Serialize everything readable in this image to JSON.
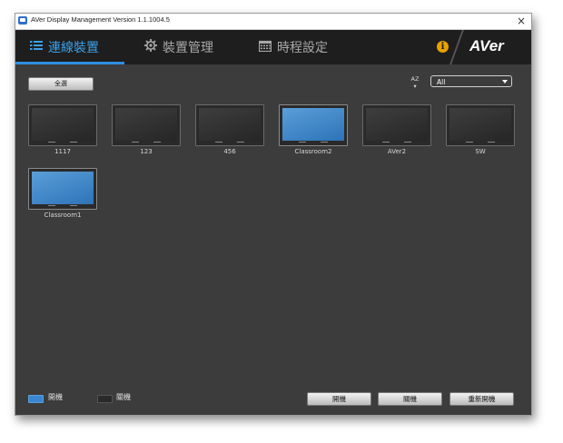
{
  "window": {
    "title": "AVer Display Management Version 1.1.1004.5",
    "close_label": "×"
  },
  "tabs": [
    {
      "label": "連線裝置",
      "icon": "list-icon",
      "active": true
    },
    {
      "label": "裝置管理",
      "icon": "gear-icon",
      "active": false
    },
    {
      "label": "時程設定",
      "icon": "calendar-icon",
      "active": false
    }
  ],
  "brand": {
    "logo_text": "AVer",
    "info_icon": "i"
  },
  "toolbar": {
    "select_all_label": "全選",
    "sort_label_top": "AZ",
    "sort_label_bottom": "▾",
    "filter_value": "All"
  },
  "devices": [
    {
      "label": "1117",
      "status": "off"
    },
    {
      "label": "123",
      "status": "off"
    },
    {
      "label": "456",
      "status": "off"
    },
    {
      "label": "Classroom2",
      "status": "on"
    },
    {
      "label": "AVer2",
      "status": "off"
    },
    {
      "label": "SW",
      "status": "off"
    },
    {
      "label": "Classroom1",
      "status": "on"
    }
  ],
  "legend": {
    "on_label": "開機",
    "off_label": "關機",
    "on_color": "#3a86d0",
    "off_color": "#2a2a2a"
  },
  "actions": {
    "power_on_label": "開機",
    "power_off_label": "關機",
    "restart_label": "重新開機"
  },
  "colors": {
    "accent": "#2f8fe0",
    "background": "#3c3c3c",
    "tabbar": "#1e1e1e"
  }
}
